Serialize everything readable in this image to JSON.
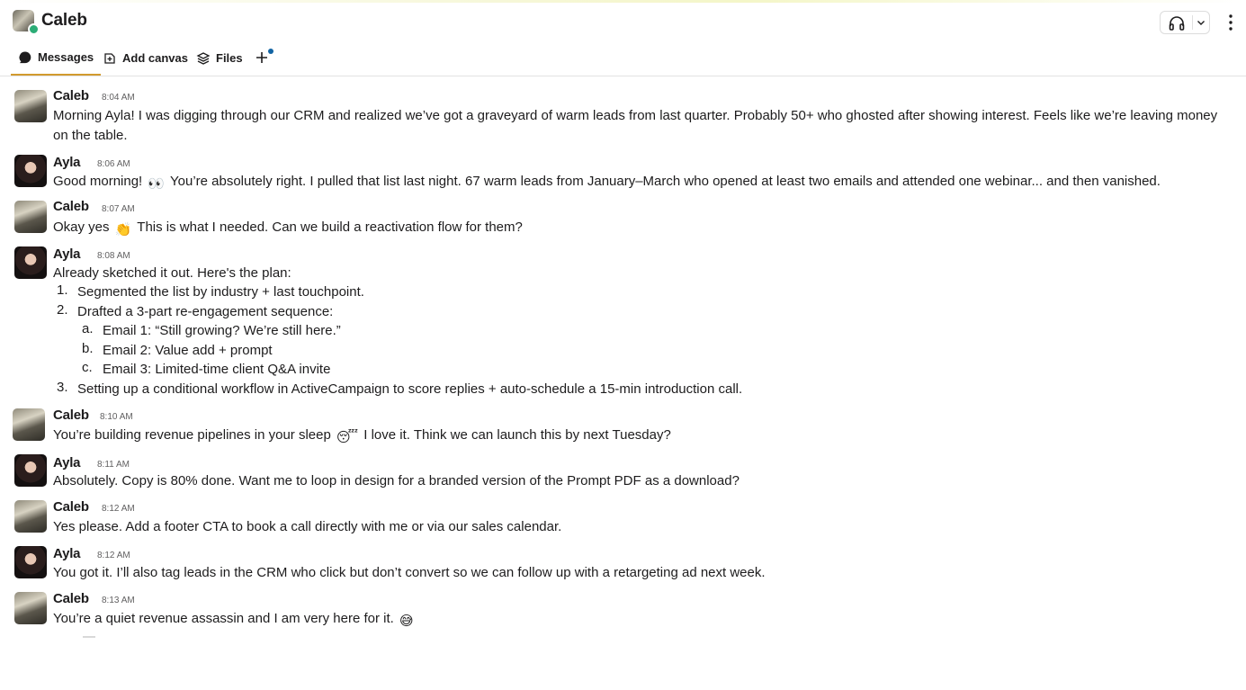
{
  "header": {
    "title": "Caleb",
    "presence_color": "#2bac76",
    "icons": {
      "huddle": "headphones-icon",
      "huddle_menu": "chevron-down-icon",
      "more": "kebab-icon"
    }
  },
  "tabs": [
    {
      "label": "Messages",
      "icon": "message-bubble-icon",
      "active": true
    },
    {
      "label": "Add canvas",
      "icon": "canvas-icon",
      "active": false
    },
    {
      "label": "Files",
      "icon": "layers-icon",
      "active": false
    }
  ],
  "accent": "#d19a2e",
  "messages": [
    {
      "author": "Caleb",
      "time": "8:04 AM",
      "text": "Morning Ayla! I was digging through our CRM and realized we’ve got a graveyard of warm leads from last quarter. Probably 50+ who ghosted after showing interest. Feels like we’re leaving money on the table."
    },
    {
      "author": "Ayla",
      "time": "8:06 AM",
      "text_before": "Good morning!",
      "emoji": "👀",
      "text_after": "You’re absolutely right. I pulled that list last night. 67 warm leads from January–March who opened at least two emails and attended one webinar... and then vanished."
    },
    {
      "author": "Caleb",
      "time": "8:07 AM",
      "text_before": "Okay yes",
      "emoji": "👏",
      "text_after": "This is what I needed. Can we build a reactivation flow for them?"
    },
    {
      "author": "Ayla",
      "time": "8:08 AM",
      "intro": "Already sketched it out. Here's the plan:",
      "items": [
        {
          "n": "1.",
          "text": "Segmented the list by industry + last touchpoint."
        },
        {
          "n": "2.",
          "text": "Drafted a 3-part re-engagement sequence:"
        },
        {
          "n": "a.",
          "text": "Email 1: “Still growing? We’re still here.”"
        },
        {
          "n": "b.",
          "text": "Email 2: Value add + prompt"
        },
        {
          "n": "c.",
          "text": "Email 3: Limited-time client Q&A invite"
        },
        {
          "n": "3.",
          "text": "Setting up a conditional workflow in ActiveCampaign to score replies + auto-schedule a 15-min introduction call."
        }
      ]
    },
    {
      "author": "Caleb",
      "time": "8:10 AM",
      "text_before": "You’re building revenue pipelines in your sleep",
      "emoji": "😴",
      "text_after": "I love it. Think we can launch this by next Tuesday?"
    },
    {
      "author": "Ayla",
      "time": "8:11 AM",
      "text": "Absolutely. Copy is 80% done. Want me to loop in design for a branded version of the Prompt PDF as a download?"
    },
    {
      "author": "Caleb",
      "time": "8:12 AM",
      "text": "Yes please. Add a footer CTA to book a call directly with me or via our sales calendar."
    },
    {
      "author": "Ayla",
      "time": "8:12 AM",
      "text": "You got it. I’ll also tag leads in the CRM who click but don’t convert so we can follow up with a retargeting ad next week."
    },
    {
      "author": "Caleb",
      "time": "8:13 AM",
      "text_before": "You’re a quiet revenue assassin and I am very here for it.",
      "emoji": "😅",
      "text_after": ""
    }
  ]
}
